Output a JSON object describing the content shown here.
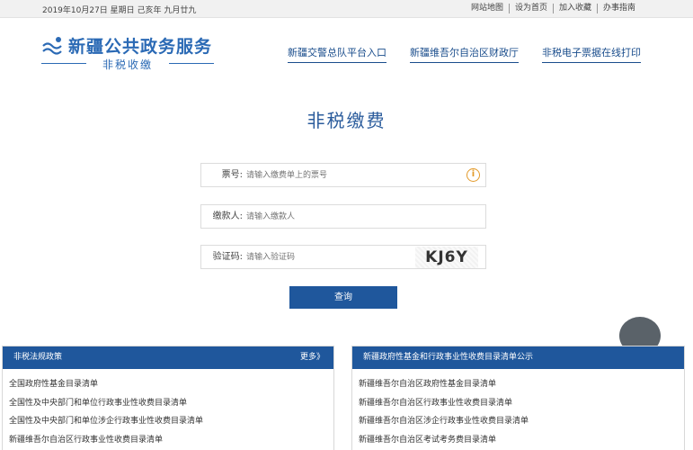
{
  "topbar": {
    "date": "2019年10月27日 星期日 己亥年 九月廿九",
    "links": [
      "网站地图",
      "设为首页",
      "加入收藏",
      "办事指南"
    ]
  },
  "logo": {
    "title": "新疆公共政务服务",
    "subtitle": "非税收缴"
  },
  "nav": [
    "新疆交警总队平台入口",
    "新疆维吾尔自治区财政厅",
    "非税电子票据在线打印"
  ],
  "page": {
    "title": "非税缴费"
  },
  "form": {
    "ticket": {
      "label": "票号:",
      "placeholder": "请输入缴费单上的票号"
    },
    "payer": {
      "label": "缴款人:",
      "placeholder": "请输入缴款人"
    },
    "captcha": {
      "label": "验证码:",
      "placeholder": "请输入验证码",
      "image_text": "KJ6Y"
    },
    "submit_label": "查询"
  },
  "panels": {
    "left": {
      "title": "非税法规政策",
      "more": "更多》",
      "items": [
        "全国政府性基金目录清单",
        "全国性及中央部门和单位行政事业性收费目录清单",
        "全国性及中央部门和单位涉企行政事业性收费目录清单",
        "新疆维吾尔自治区行政事业性收费目录清单"
      ]
    },
    "right": {
      "title": "新疆政府性基金和行政事业性收费目录清单公示",
      "items": [
        "新疆维吾尔自治区政府性基金目录清单",
        "新疆维吾尔自治区行政事业性收费目录清单",
        "新疆维吾尔自治区涉企行政事业性收费目录清单",
        "新疆维吾尔自治区考试考务费目录清单"
      ]
    }
  },
  "colors": {
    "brand": "#2b6ab5",
    "button": "#1f579c",
    "info": "#e39a2a"
  }
}
